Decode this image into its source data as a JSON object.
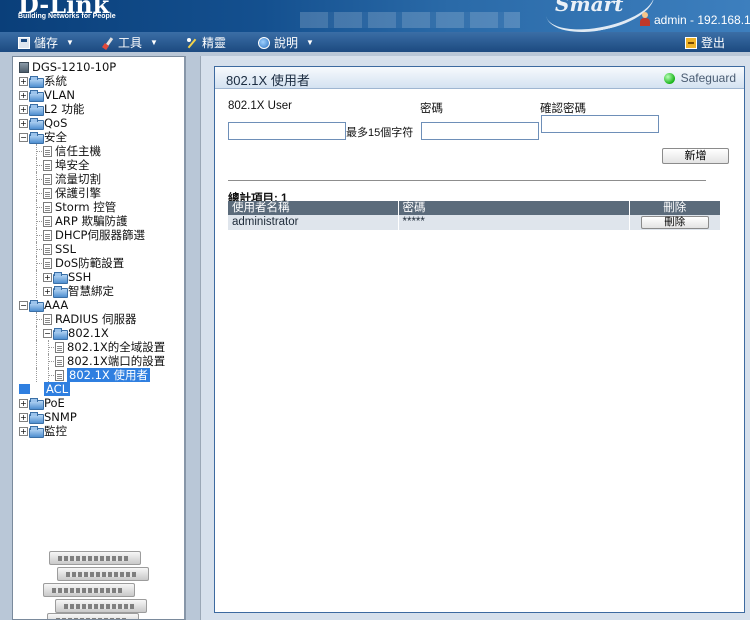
{
  "header": {
    "brand": "D-Link",
    "tagline": "Building Networks for People",
    "product_swoosh_text": "Smart",
    "user_info": "admin - 192.168.1"
  },
  "menu": {
    "items": [
      {
        "label": "儲存",
        "icon": "save-icon"
      },
      {
        "label": "工具",
        "icon": "tools-icon"
      },
      {
        "label": "精靈",
        "icon": "wizard-icon"
      },
      {
        "label": "說明",
        "icon": "help-icon"
      }
    ],
    "logout": {
      "label": "登出",
      "icon": "logout-icon"
    }
  },
  "tree": {
    "root": "DGS-1210-10P",
    "items": [
      {
        "label": "系統"
      },
      {
        "label": "VLAN"
      },
      {
        "label": "L2 功能"
      },
      {
        "label": "QoS"
      },
      {
        "label": "安全"
      },
      {
        "label": "信任主機"
      },
      {
        "label": "埠安全"
      },
      {
        "label": "流量切割"
      },
      {
        "label": "保護引擎"
      },
      {
        "label": "Storm 控管"
      },
      {
        "label": "ARP 欺騙防護"
      },
      {
        "label": "DHCP伺服器篩選"
      },
      {
        "label": "SSL"
      },
      {
        "label": "DoS防範設置"
      },
      {
        "label": "SSH"
      },
      {
        "label": "智慧綁定"
      },
      {
        "label": "AAA"
      },
      {
        "label": "RADIUS 伺服器"
      },
      {
        "label": "802.1X"
      },
      {
        "label": "802.1X的全域設置"
      },
      {
        "label": "802.1X端口的設置"
      },
      {
        "label": "802.1X 使用者"
      },
      {
        "label": "ACL"
      },
      {
        "label": "PoE"
      },
      {
        "label": "SNMP"
      },
      {
        "label": "監控"
      }
    ]
  },
  "panel": {
    "title": "802.1X 使用者",
    "safeguard": "Safeguard",
    "form": {
      "user_label": "802.1X User",
      "user_value": "",
      "password_label": "密碼",
      "password_hint": "最多15個字符",
      "password_value": "",
      "confirm_label": "確認密碼",
      "confirm_value": "",
      "add_button": "新增"
    },
    "total": "總計項目: 1",
    "table": {
      "headers": [
        "使用者名稱",
        "密碼",
        "刪除"
      ],
      "rows": [
        {
          "username": "administrator",
          "password": "*****",
          "delete": "刪除"
        }
      ]
    }
  }
}
